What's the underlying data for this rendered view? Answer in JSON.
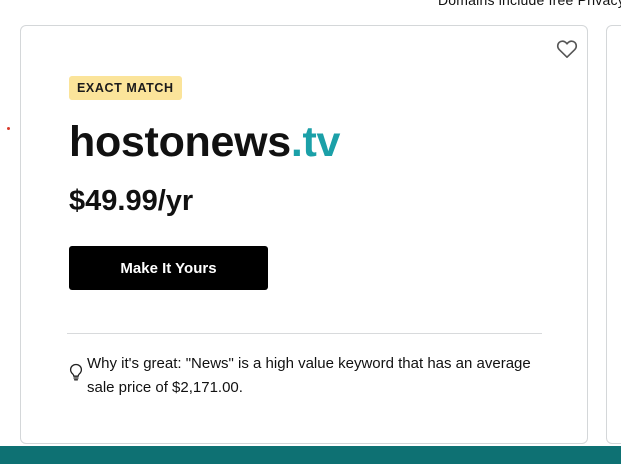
{
  "top_note": "Domains include free Privacy",
  "card": {
    "badge": "EXACT MATCH",
    "domain_name": "hostonews",
    "domain_tld": ".tv",
    "price": "$49.99/yr",
    "cta_label": "Make It Yours",
    "why_text": "Why it's great: \"News\" is a high value keyword that has an average sale price of $2,171.00.",
    "favorite_icon": "heart-outline-icon",
    "tip_icon": "lightbulb-icon"
  },
  "colors": {
    "badge_bg": "#fbe49a",
    "tld": "#1ba0a8",
    "cta_bg": "#000000",
    "footer_bar": "#0e7173"
  }
}
